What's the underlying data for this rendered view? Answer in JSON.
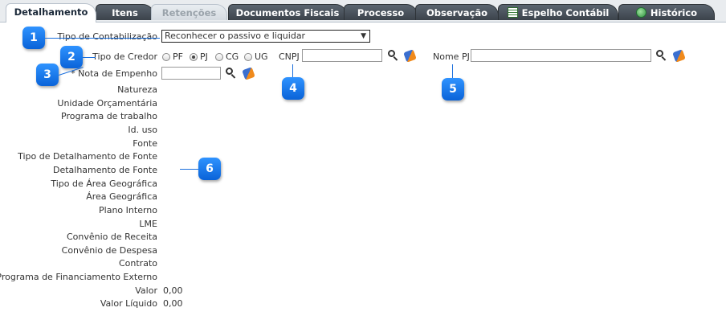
{
  "tabs": [
    {
      "label": "Detalhamento",
      "state": "active"
    },
    {
      "label": "Itens",
      "state": "normal"
    },
    {
      "label": "Retenções",
      "state": "disabled"
    },
    {
      "label": "Documentos Fiscais",
      "state": "normal"
    },
    {
      "label": "Processo",
      "state": "normal"
    },
    {
      "label": "Observação",
      "state": "normal"
    },
    {
      "label": "Espelho Contábil",
      "state": "normal",
      "icon": "spreadsheet-icon"
    },
    {
      "label": "Histórico",
      "state": "normal",
      "icon": "globe-icon"
    }
  ],
  "form": {
    "tipo_contabilizacao": {
      "label": "Tipo de Contabilização",
      "value": "Reconhecer o passivo e liquidar"
    },
    "tipo_credor": {
      "label": "Tipo de Credor",
      "options": [
        "PF",
        "PJ",
        "CG",
        "UG"
      ],
      "selected": "PJ"
    },
    "cnpj": {
      "label": "CNPJ",
      "value": ""
    },
    "nome_pj": {
      "label": "Nome PJ",
      "value": ""
    },
    "nota_empenho": {
      "required_mark": "*",
      "label": "Nota de Empenho",
      "value": ""
    },
    "fields": [
      {
        "label": "Natureza",
        "value": ""
      },
      {
        "label": "Unidade Orçamentária",
        "value": ""
      },
      {
        "label": "Programa de trabalho",
        "value": ""
      },
      {
        "label": "Id. uso",
        "value": ""
      },
      {
        "label": "Fonte",
        "value": ""
      },
      {
        "label": "Tipo de Detalhamento de Fonte",
        "value": ""
      },
      {
        "label": "Detalhamento de Fonte",
        "value": ""
      },
      {
        "label": "Tipo de Área Geográfica",
        "value": ""
      },
      {
        "label": "Área Geográfica",
        "value": ""
      },
      {
        "label": "Plano Interno",
        "value": ""
      },
      {
        "label": "LME",
        "value": ""
      },
      {
        "label": "Convênio de Receita",
        "value": ""
      },
      {
        "label": "Convênio de Despesa",
        "value": ""
      },
      {
        "label": "Contrato",
        "value": ""
      },
      {
        "label": "Programa de Financiamento Externo",
        "value": ""
      },
      {
        "label": "Valor",
        "value": "0,00"
      },
      {
        "label": "Valor Líquido",
        "value": "0,00"
      }
    ]
  },
  "callouts": [
    "1",
    "2",
    "3",
    "4",
    "5",
    "6"
  ],
  "colors": {
    "callout": "#0a63d8",
    "tab_dark": "#3c434b"
  }
}
